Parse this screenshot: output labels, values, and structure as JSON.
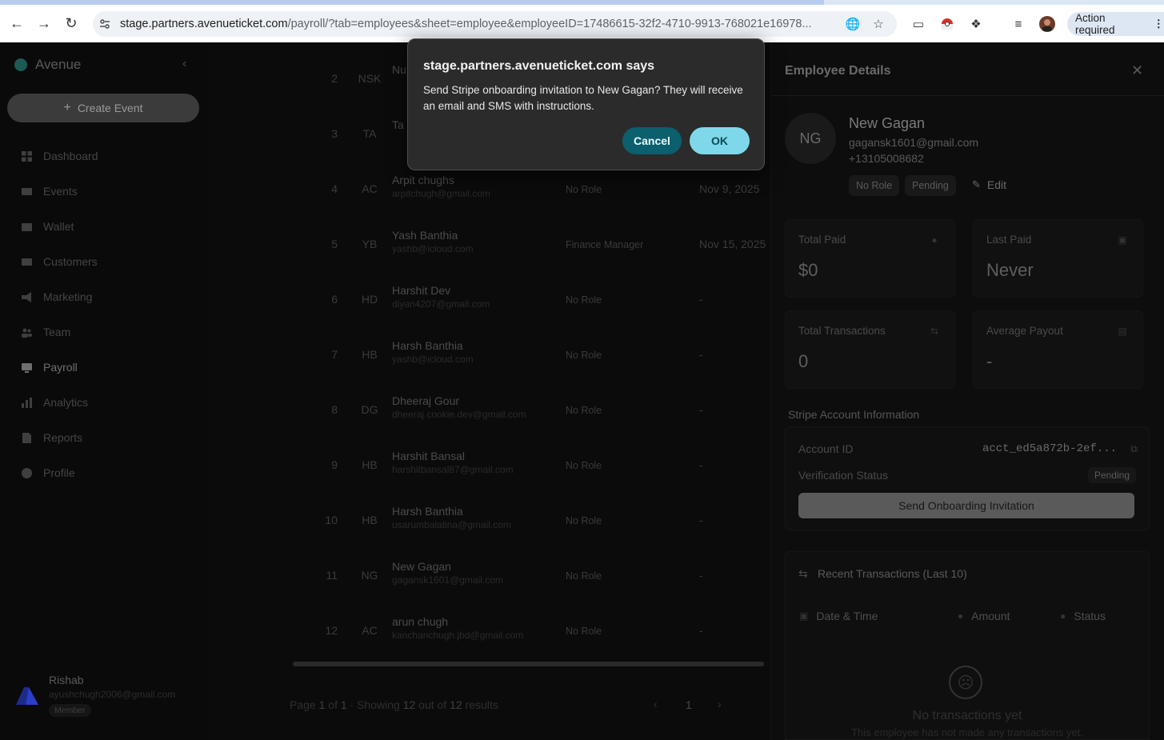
{
  "browser": {
    "url_host": "stage.partners.avenueticket.com",
    "url_path": "/payroll/?tab=employees&sheet=employee&employeeID=17486615-32f2-4710-9913-768021e16978...",
    "action_required": "Action required"
  },
  "sidebar": {
    "brand": "Avenue",
    "create_event": "Create Event",
    "items": [
      {
        "label": "Dashboard",
        "icon": "grid-icon"
      },
      {
        "label": "Events",
        "icon": "ticket-icon"
      },
      {
        "label": "Wallet",
        "icon": "wallet-icon"
      },
      {
        "label": "Customers",
        "icon": "id-card-icon"
      },
      {
        "label": "Marketing",
        "icon": "megaphone-icon"
      },
      {
        "label": "Team",
        "icon": "users-icon"
      },
      {
        "label": "Payroll",
        "icon": "payroll-icon"
      },
      {
        "label": "Analytics",
        "icon": "analytics-icon"
      },
      {
        "label": "Reports",
        "icon": "document-icon"
      },
      {
        "label": "Profile",
        "icon": "user-circle-icon"
      }
    ],
    "user": {
      "name": "Rishab",
      "email": "ayushchugh2006@gmail.com",
      "role": "Member"
    }
  },
  "table": {
    "rows": [
      {
        "num": "2",
        "initials": "NSK",
        "name": "Nu",
        "email": "",
        "role": "",
        "date": ""
      },
      {
        "num": "3",
        "initials": "TA",
        "name": "Ta",
        "email": "",
        "role": "",
        "date": ""
      },
      {
        "num": "4",
        "initials": "AC",
        "name": "Arpit chughs",
        "email": "arpitchugh@gmail.com",
        "role": "No Role",
        "date": "Nov 9, 2025"
      },
      {
        "num": "5",
        "initials": "YB",
        "name": "Yash Banthia",
        "email": "yashb@icloud.com",
        "role": "Finance Manager",
        "date": "Nov 15, 2025"
      },
      {
        "num": "6",
        "initials": "HD",
        "name": "Harshit Dev",
        "email": "diyan4207@gmail.com",
        "role": "No Role",
        "date": "-"
      },
      {
        "num": "7",
        "initials": "HB",
        "name": "Harsh Banthia",
        "email": "yashb@icloud.com",
        "role": "No Role",
        "date": "-"
      },
      {
        "num": "8",
        "initials": "DG",
        "name": "Dheeraj Gour",
        "email": "dheeraj.cookie.dev@gmail.com",
        "role": "No Role",
        "date": "-"
      },
      {
        "num": "9",
        "initials": "HB",
        "name": "Harshit Bansal",
        "email": "harshitbansal87@gmail.com",
        "role": "No Role",
        "date": "-"
      },
      {
        "num": "10",
        "initials": "HB",
        "name": "Harsh Banthia",
        "email": "usarumbalatina@gmail.com",
        "role": "No Role",
        "date": "-"
      },
      {
        "num": "11",
        "initials": "NG",
        "name": "New Gagan",
        "email": "gagansk1601@gmail.com",
        "role": "No Role",
        "date": "-"
      },
      {
        "num": "12",
        "initials": "AC",
        "name": "arun chugh",
        "email": "kanchanchugh.jbd@gmail.com",
        "role": "No Role",
        "date": "-"
      }
    ],
    "pager": {
      "page": "1",
      "of": "1",
      "showing": "12",
      "total": "12",
      "current": "1"
    }
  },
  "panel": {
    "title": "Employee Details",
    "initials": "NG",
    "name": "New Gagan",
    "email": "gagansk1601@gmail.com",
    "phone": "+13105008682",
    "role_chip": "No Role",
    "status_chip": "Pending",
    "edit": "Edit",
    "stats": [
      {
        "label": "Total Paid",
        "value": "$0"
      },
      {
        "label": "Last Paid",
        "value": "Never"
      },
      {
        "label": "Total Transactions",
        "value": "0"
      },
      {
        "label": "Average Payout",
        "value": "-"
      }
    ],
    "stripe": {
      "section_title": "Stripe Account Information",
      "account_label": "Account ID",
      "account_value": "acct_ed5a872b-2ef...",
      "verification_label": "Verification Status",
      "verification_value": "Pending",
      "send_button": "Send Onboarding Invitation"
    },
    "transactions": {
      "title": "Recent Transactions (Last 10)",
      "col_date": "Date & Time",
      "col_amount": "Amount",
      "col_status": "Status",
      "empty_title": "No transactions yet",
      "empty_sub": "This employee has not made any transactions yet."
    }
  },
  "dialog": {
    "title": "stage.partners.avenueticket.com says",
    "message": "Send Stripe onboarding invitation to New Gagan? They will receive an email and SMS with instructions.",
    "cancel": "Cancel",
    "ok": "OK"
  }
}
